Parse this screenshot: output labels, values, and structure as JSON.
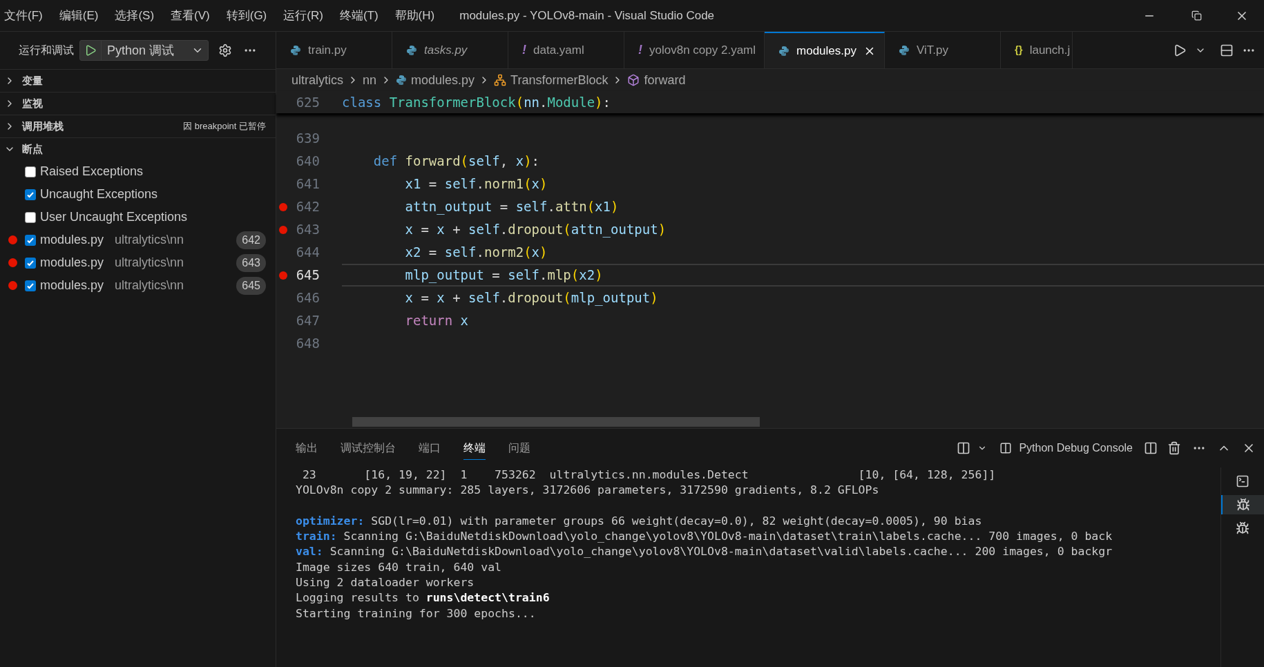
{
  "menu": [
    "文件(F)",
    "编辑(E)",
    "选择(S)",
    "查看(V)",
    "转到(G)",
    "运行(R)",
    "终端(T)",
    "帮助(H)"
  ],
  "window": {
    "title": "modules.py - YOLOv8-main - Visual Studio Code"
  },
  "sidebar": {
    "title": "运行和调试",
    "config": "Python 调试",
    "sections": [
      {
        "label": "变量",
        "expanded": false
      },
      {
        "label": "监视",
        "expanded": false
      },
      {
        "label": "调用堆栈",
        "expanded": false,
        "status": "因 breakpoint 已暂停"
      },
      {
        "label": "断点",
        "expanded": true
      }
    ],
    "breakpoints": [
      {
        "kind": "exception",
        "label": "Raised Exceptions",
        "checked": false
      },
      {
        "kind": "exception",
        "label": "Uncaught Exceptions",
        "checked": true
      },
      {
        "kind": "exception",
        "label": "User Uncaught Exceptions",
        "checked": false
      },
      {
        "kind": "file",
        "label": "modules.py",
        "path": "ultralytics\\nn",
        "line": "642",
        "checked": true
      },
      {
        "kind": "file",
        "label": "modules.py",
        "path": "ultralytics\\nn",
        "line": "643",
        "checked": true
      },
      {
        "kind": "file",
        "label": "modules.py",
        "path": "ultralytics\\nn",
        "line": "645",
        "checked": true
      }
    ]
  },
  "tabs": [
    {
      "label": "train.py",
      "kind": "python",
      "italic": false,
      "selected": false
    },
    {
      "label": "tasks.py",
      "kind": "python",
      "italic": true,
      "selected": false
    },
    {
      "label": "data.yaml",
      "kind": "yaml",
      "glyph": "!",
      "italic": false,
      "selected": false
    },
    {
      "label": "yolov8n copy 2.yaml",
      "kind": "yaml",
      "glyph": "!",
      "italic": false,
      "selected": false
    },
    {
      "label": "modules.py",
      "kind": "python",
      "italic": false,
      "selected": true
    },
    {
      "label": "ViT.py",
      "kind": "python",
      "italic": false,
      "selected": false
    },
    {
      "label": "launch.j",
      "kind": "json",
      "glyph": "{}",
      "italic": false,
      "selected": false
    }
  ],
  "breadcrumb": [
    {
      "kind": "folder",
      "text": "ultralytics"
    },
    {
      "kind": "folder",
      "text": "nn"
    },
    {
      "kind": "python",
      "text": "modules.py"
    },
    {
      "kind": "class",
      "text": "TransformerBlock"
    },
    {
      "kind": "method",
      "text": "forward"
    }
  ],
  "sticky": {
    "number": "625",
    "tokens": [
      {
        "kind": "keyword",
        "text": "class "
      },
      {
        "kind": "type",
        "text": "TransformerBlock"
      },
      {
        "kind": "paren",
        "text": "("
      },
      {
        "kind": "var",
        "text": "nn"
      },
      {
        "kind": "plain",
        "text": "."
      },
      {
        "kind": "type",
        "text": "Module"
      },
      {
        "kind": "paren",
        "text": ")"
      },
      {
        "kind": "plain",
        "text": ":"
      }
    ]
  },
  "lines": [
    {
      "number": "639",
      "breakpoint": false,
      "current": false
    },
    {
      "number": "640",
      "breakpoint": false,
      "current": false,
      "tokens": [
        {
          "kind": "keyword",
          "text": "    def "
        },
        {
          "kind": "func",
          "text": "forward"
        },
        {
          "kind": "paren",
          "text": "("
        },
        {
          "kind": "var",
          "text": "self"
        },
        {
          "kind": "plain",
          "text": ", "
        },
        {
          "kind": "var",
          "text": "x"
        },
        {
          "kind": "paren",
          "text": ")"
        },
        {
          "kind": "plain",
          "text": ":"
        }
      ]
    },
    {
      "number": "641",
      "breakpoint": false,
      "current": false,
      "tokens": [
        {
          "kind": "var",
          "text": "        x1"
        },
        {
          "kind": "plain",
          "text": " = "
        },
        {
          "kind": "var",
          "text": "self"
        },
        {
          "kind": "plain",
          "text": "."
        },
        {
          "kind": "func",
          "text": "norm1"
        },
        {
          "kind": "paren",
          "text": "("
        },
        {
          "kind": "var",
          "text": "x"
        },
        {
          "kind": "paren",
          "text": ")"
        }
      ]
    },
    {
      "number": "642",
      "breakpoint": true,
      "current": false,
      "tokens": [
        {
          "kind": "var",
          "text": "        attn_output"
        },
        {
          "kind": "plain",
          "text": " = "
        },
        {
          "kind": "var",
          "text": "self"
        },
        {
          "kind": "plain",
          "text": "."
        },
        {
          "kind": "func",
          "text": "attn"
        },
        {
          "kind": "paren",
          "text": "("
        },
        {
          "kind": "var",
          "text": "x1"
        },
        {
          "kind": "paren",
          "text": ")"
        }
      ]
    },
    {
      "number": "643",
      "breakpoint": true,
      "current": false,
      "tokens": [
        {
          "kind": "var",
          "text": "        x"
        },
        {
          "kind": "plain",
          "text": " = "
        },
        {
          "kind": "var",
          "text": "x"
        },
        {
          "kind": "plain",
          "text": " + "
        },
        {
          "kind": "var",
          "text": "self"
        },
        {
          "kind": "plain",
          "text": "."
        },
        {
          "kind": "func",
          "text": "dropout"
        },
        {
          "kind": "paren",
          "text": "("
        },
        {
          "kind": "var",
          "text": "attn_output"
        },
        {
          "kind": "paren",
          "text": ")"
        }
      ]
    },
    {
      "number": "644",
      "breakpoint": false,
      "current": false,
      "tokens": [
        {
          "kind": "var",
          "text": "        x2"
        },
        {
          "kind": "plain",
          "text": " = "
        },
        {
          "kind": "var",
          "text": "self"
        },
        {
          "kind": "plain",
          "text": "."
        },
        {
          "kind": "func",
          "text": "norm2"
        },
        {
          "kind": "paren",
          "text": "("
        },
        {
          "kind": "var",
          "text": "x"
        },
        {
          "kind": "paren",
          "text": ")"
        }
      ]
    },
    {
      "number": "645",
      "breakpoint": true,
      "current": true,
      "tokens": [
        {
          "kind": "var",
          "text": "        mlp_output"
        },
        {
          "kind": "plain",
          "text": " = "
        },
        {
          "kind": "var",
          "text": "self"
        },
        {
          "kind": "plain",
          "text": "."
        },
        {
          "kind": "func",
          "text": "mlp"
        },
        {
          "kind": "paren",
          "text": "("
        },
        {
          "kind": "var",
          "text": "x2"
        },
        {
          "kind": "paren",
          "text": ")"
        }
      ]
    },
    {
      "number": "646",
      "breakpoint": false,
      "current": false,
      "tokens": [
        {
          "kind": "var",
          "text": "        x"
        },
        {
          "kind": "plain",
          "text": " = "
        },
        {
          "kind": "var",
          "text": "x"
        },
        {
          "kind": "plain",
          "text": " + "
        },
        {
          "kind": "var",
          "text": "self"
        },
        {
          "kind": "plain",
          "text": "."
        },
        {
          "kind": "func",
          "text": "dropout"
        },
        {
          "kind": "paren",
          "text": "("
        },
        {
          "kind": "var",
          "text": "mlp_output"
        },
        {
          "kind": "paren",
          "text": ")"
        }
      ]
    },
    {
      "number": "647",
      "breakpoint": false,
      "current": false,
      "tokens": [
        {
          "kind": "control",
          "text": "        return "
        },
        {
          "kind": "var",
          "text": "x"
        }
      ]
    },
    {
      "number": "648",
      "breakpoint": false,
      "current": false
    }
  ],
  "panel": {
    "tabs": [
      {
        "label": "输出",
        "selected": false
      },
      {
        "label": "调试控制台",
        "selected": false
      },
      {
        "label": "端口",
        "selected": false
      },
      {
        "label": "终端",
        "selected": true
      },
      {
        "label": "问题",
        "selected": false
      }
    ],
    "terminal_name": "Python Debug Console",
    "terminals": [
      {
        "kind": "shell",
        "selected": false
      },
      {
        "kind": "debug",
        "selected": true
      },
      {
        "kind": "debug",
        "selected": false
      }
    ],
    "output": [
      {
        "kind": "text",
        "spans": [
          {
            "kind": "plain",
            "text": " 23       [16, 19, 22]  1    753262  ultralytics.nn.modules.Detect                [10, [64, 128, 256]]"
          }
        ]
      },
      {
        "kind": "text",
        "spans": [
          {
            "kind": "plain",
            "text": "YOLOv8n copy 2 summary: 285 layers, 3172606 parameters, 3172590 gradients, 8.2 GFLOPs"
          }
        ]
      },
      {
        "kind": "blank"
      },
      {
        "kind": "text",
        "spans": [
          {
            "kind": "label",
            "text": "optimizer:"
          },
          {
            "kind": "plain",
            "text": " SGD(lr=0.01) with parameter groups 66 weight(decay=0.0), 82 weight(decay=0.0005), 90 bias"
          }
        ]
      },
      {
        "kind": "text",
        "spans": [
          {
            "kind": "label",
            "text": "train:"
          },
          {
            "kind": "plain",
            "text": " Scanning G:\\BaiduNetdiskDownload\\yolo_change\\yolov8\\YOLOv8-main\\dataset\\train\\labels.cache... 700 images, 0 back"
          }
        ]
      },
      {
        "kind": "text",
        "spans": [
          {
            "kind": "label",
            "text": "val:"
          },
          {
            "kind": "plain",
            "text": " Scanning G:\\BaiduNetdiskDownload\\yolo_change\\yolov8\\YOLOv8-main\\dataset\\valid\\labels.cache... 200 images, 0 backgr"
          }
        ]
      },
      {
        "kind": "text",
        "spans": [
          {
            "kind": "plain",
            "text": "Image sizes 640 train, 640 val"
          }
        ]
      },
      {
        "kind": "text",
        "spans": [
          {
            "kind": "plain",
            "text": "Using 2 dataloader workers"
          }
        ]
      },
      {
        "kind": "text",
        "spans": [
          {
            "kind": "plain",
            "text": "Logging results to "
          },
          {
            "kind": "bold",
            "text": "runs\\detect\\train6"
          }
        ]
      },
      {
        "kind": "text",
        "spans": [
          {
            "kind": "plain",
            "text": "Starting training for 300 epochs..."
          }
        ]
      }
    ]
  }
}
